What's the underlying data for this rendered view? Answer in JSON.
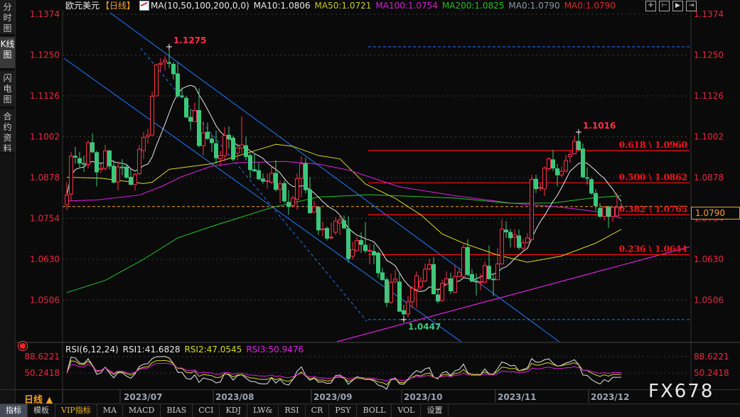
{
  "sidebar": {
    "tabs": [
      {
        "label": "分时图",
        "active": false
      },
      {
        "label": "K线图",
        "active": true
      },
      {
        "label": "闪电图",
        "active": false
      },
      {
        "label": "合约资料",
        "active": false
      }
    ]
  },
  "header": {
    "symbol": "欧元美元",
    "period": "【日线】",
    "ma_params": "MA(10,50,100,200,0,0)",
    "ma10": "MA10:1.0806",
    "ma50": "MA50:1.0721",
    "ma100": "MA100:1.0754",
    "ma200": "MA200:1.0825",
    "ma0a": "MA0:1.0790",
    "ma0b": "MA0:1.0790",
    "tool_icons": [
      "crosshair-icon",
      "zoom-range-icon",
      "play-icon",
      "exit-right-icon"
    ]
  },
  "current_price": "1.0790",
  "rsi": {
    "params": "RSI(6,12,24)",
    "rsi1": "RSI1:41.6828",
    "rsi2": "RSI2:47.0545",
    "rsi3": "RSI3:50.9476",
    "levels": [
      "88.6221",
      "50.2418"
    ]
  },
  "date_axis": {
    "period_label": "日线 ▲",
    "months": [
      "2023/07",
      "2023/08",
      "2023/09",
      "2023/10",
      "2023/11",
      "2023/12"
    ]
  },
  "bottom_tabs": [
    {
      "label": "指标",
      "active": true
    },
    {
      "label": "模板"
    },
    {
      "label": "VIP指标",
      "vip": true
    },
    {
      "label": "MA"
    },
    {
      "label": "MACD"
    },
    {
      "label": "BIAS"
    },
    {
      "label": "CCI"
    },
    {
      "label": "KDJ"
    },
    {
      "label": "LW&"
    },
    {
      "label": "RSI"
    },
    {
      "label": "CR"
    },
    {
      "label": "PSY"
    },
    {
      "label": "BOLL"
    },
    {
      "label": "VOL"
    },
    {
      "label": "设置"
    }
  ],
  "watermark": "FX678",
  "colors": {
    "up": "#ff3048",
    "down": "#3cc87c",
    "ma10": "#e8e8e8",
    "ma50": "#d8d820",
    "ma100": "#e020e0",
    "ma200": "#20c830",
    "axis_text": "#e8283c",
    "fib": "#ff1010",
    "trend": "#1e7cff",
    "support": "#e020e0",
    "last_price": "#f0a030"
  },
  "chart_data": {
    "type": "candlestick",
    "title": "欧元美元",
    "y_ticks": [
      "1.1374",
      "1.1250",
      "1.1126",
      "1.1002",
      "1.0878",
      "1.0754",
      "1.0630",
      "1.0506"
    ],
    "ylim": [
      1.038,
      1.1374
    ],
    "x_ticks": [
      "2023/07",
      "2023/08",
      "2023/09",
      "2023/10",
      "2023/11",
      "2023/12"
    ],
    "candles_ohlc": [
      [
        1.0796,
        1.0864,
        1.0779,
        1.0825
      ],
      [
        1.0828,
        1.0956,
        1.0807,
        1.0943
      ],
      [
        1.0943,
        1.0971,
        1.092,
        1.094
      ],
      [
        1.0936,
        1.0956,
        1.091,
        1.0922
      ],
      [
        1.0921,
        1.0945,
        1.0895,
        1.092
      ],
      [
        1.0918,
        1.0991,
        1.0906,
        1.0984
      ],
      [
        1.0984,
        1.1012,
        1.0952,
        1.0956
      ],
      [
        1.0954,
        1.0959,
        1.0851,
        1.0895
      ],
      [
        1.0903,
        1.092,
        1.0892,
        1.0906
      ],
      [
        1.0906,
        1.0978,
        1.0899,
        1.0959
      ],
      [
        1.0959,
        1.0963,
        1.0903,
        1.0913
      ],
      [
        1.0913,
        1.0931,
        1.086,
        1.0864
      ],
      [
        1.0865,
        1.0927,
        1.0839,
        1.091
      ],
      [
        1.091,
        1.0934,
        1.0885,
        1.0908
      ],
      [
        1.091,
        1.092,
        1.0874,
        1.0879
      ],
      [
        1.0879,
        1.0903,
        1.0855,
        1.0857
      ],
      [
        1.0857,
        1.0892,
        1.0839,
        1.0888
      ],
      [
        1.089,
        1.0977,
        1.0885,
        1.0964
      ],
      [
        1.096,
        1.1016,
        1.0934,
        1.1
      ],
      [
        1.1002,
        1.1027,
        1.0981,
        1.1007
      ],
      [
        1.1007,
        1.1139,
        1.1005,
        1.1125
      ],
      [
        1.1126,
        1.1224,
        1.1126,
        1.122
      ],
      [
        1.1222,
        1.1241,
        1.12,
        1.1225
      ],
      [
        1.1229,
        1.1246,
        1.1204,
        1.1234
      ],
      [
        1.1227,
        1.1275,
        1.1211,
        1.1225
      ],
      [
        1.1222,
        1.1229,
        1.1176,
        1.1193
      ],
      [
        1.1193,
        1.1227,
        1.1119,
        1.1126
      ],
      [
        1.1126,
        1.1151,
        1.1119,
        1.1124
      ],
      [
        1.1119,
        1.1126,
        1.1059,
        1.1062
      ],
      [
        1.1061,
        1.1087,
        1.1021,
        1.1049
      ],
      [
        1.1048,
        1.1106,
        1.1048,
        1.1082
      ],
      [
        1.1082,
        1.1149,
        1.097,
        1.0975
      ],
      [
        1.0975,
        1.1048,
        1.0945,
        1.1014
      ],
      [
        1.1016,
        1.1045,
        1.0992,
        1.0997
      ],
      [
        1.0995,
        1.1009,
        1.0956,
        1.0984
      ],
      [
        1.0981,
        1.1021,
        1.092,
        1.0938
      ],
      [
        1.0935,
        1.0959,
        1.0912,
        1.0945
      ],
      [
        1.0945,
        1.1032,
        1.0927,
        1.1006
      ],
      [
        1.1007,
        1.1034,
        1.0966,
        1.0995
      ],
      [
        1.0998,
        1.1006,
        1.0927,
        1.0934
      ],
      [
        1.0952,
        1.0981,
        1.093,
        1.0968
      ],
      [
        1.0968,
        1.1063,
        1.0952,
        1.0977
      ],
      [
        1.0975,
        1.1002,
        1.093,
        1.0942
      ],
      [
        1.0945,
        1.0952,
        1.0877,
        1.0902
      ],
      [
        1.0902,
        1.0952,
        1.0896,
        1.0898
      ],
      [
        1.0899,
        1.0923,
        1.087,
        1.0874
      ],
      [
        1.0874,
        1.0891,
        1.0859,
        1.0867
      ],
      [
        1.0866,
        1.0891,
        1.0844,
        1.0868
      ],
      [
        1.0864,
        1.0912,
        1.0859,
        1.0891
      ],
      [
        1.0891,
        1.0931,
        1.0836,
        1.0842
      ],
      [
        1.0842,
        1.0869,
        1.0801,
        1.0859
      ],
      [
        1.086,
        1.0869,
        1.0801,
        1.0807
      ],
      [
        1.0803,
        1.0841,
        1.0765,
        1.079
      ],
      [
        1.0793,
        1.0823,
        1.0787,
        1.0816
      ],
      [
        1.0812,
        1.0891,
        1.078,
        1.0875
      ],
      [
        1.0876,
        1.0942,
        1.0819,
        1.092
      ],
      [
        1.092,
        1.0938,
        1.083,
        1.0841
      ],
      [
        1.0841,
        1.088,
        1.0769,
        1.0771
      ],
      [
        1.0773,
        1.0807,
        1.0771,
        1.079
      ],
      [
        1.0788,
        1.079,
        1.0704,
        1.0719
      ],
      [
        1.072,
        1.0744,
        1.07,
        1.0722
      ],
      [
        1.0724,
        1.073,
        1.0687,
        1.0694
      ],
      [
        1.0695,
        1.0742,
        1.0692,
        1.0697
      ],
      [
        1.0712,
        1.0758,
        1.0704,
        1.0746
      ],
      [
        1.074,
        1.0765,
        1.0704,
        1.075
      ],
      [
        1.0747,
        1.0763,
        1.0722,
        1.0725
      ],
      [
        1.0723,
        1.0761,
        1.062,
        1.0632
      ],
      [
        1.0639,
        1.0683,
        1.063,
        1.0659
      ],
      [
        1.0656,
        1.0697,
        1.0654,
        1.0687
      ],
      [
        1.0687,
        1.0712,
        1.0649,
        1.0675
      ],
      [
        1.0673,
        1.0743,
        1.0649,
        1.0656
      ],
      [
        1.0655,
        1.0676,
        1.0615,
        1.0657
      ],
      [
        1.0654,
        1.0676,
        1.0615,
        1.0643
      ],
      [
        1.0649,
        1.0654,
        1.0575,
        1.0589
      ],
      [
        1.0589,
        1.0604,
        1.0565,
        1.0568
      ],
      [
        1.0568,
        1.0575,
        1.0485,
        1.0499
      ],
      [
        1.0499,
        1.0586,
        1.0495,
        1.056
      ],
      [
        1.0563,
        1.0597,
        1.0557,
        1.057
      ],
      [
        1.0561,
        1.0589,
        1.0472,
        1.0472
      ],
      [
        1.0474,
        1.0492,
        1.0447,
        1.0464
      ],
      [
        1.0464,
        1.0518,
        1.0453,
        1.0501
      ],
      [
        1.0501,
        1.0549,
        1.0482,
        1.0542
      ],
      [
        1.0539,
        1.0593,
        1.0482,
        1.058
      ],
      [
        1.0546,
        1.0575,
        1.0536,
        1.0563
      ],
      [
        1.0564,
        1.0617,
        1.056,
        1.06
      ],
      [
        1.0601,
        1.0632,
        1.0596,
        1.0614
      ],
      [
        1.0614,
        1.0636,
        1.0525,
        1.0525
      ],
      [
        1.0522,
        1.0542,
        1.0496,
        1.0503
      ],
      [
        1.0505,
        1.0568,
        1.0501,
        1.0557
      ],
      [
        1.0555,
        1.0593,
        1.055,
        1.0571
      ],
      [
        1.0571,
        1.0589,
        1.0524,
        1.0534
      ],
      [
        1.053,
        1.0611,
        1.0528,
        1.0578
      ],
      [
        1.0578,
        1.0604,
        1.0575,
        1.0591
      ],
      [
        1.0578,
        1.0675,
        1.0575,
        1.0666
      ],
      [
        1.0666,
        1.0691,
        1.0578,
        1.0584
      ],
      [
        1.0584,
        1.06,
        1.0561,
        1.0563
      ],
      [
        1.0564,
        1.0586,
        1.052,
        1.0561
      ],
      [
        1.0561,
        1.0586,
        1.0536,
        1.0562
      ],
      [
        1.0561,
        1.0623,
        1.0557,
        1.0611
      ],
      [
        1.0609,
        1.0672,
        1.0568,
        1.0571
      ],
      [
        1.057,
        1.0586,
        1.0518,
        1.0568
      ],
      [
        1.0568,
        1.0664,
        1.0566,
        1.0616
      ],
      [
        1.0616,
        1.0751,
        1.0614,
        1.0722
      ],
      [
        1.0719,
        1.0746,
        1.0695,
        1.0713
      ],
      [
        1.0712,
        1.0722,
        1.0666,
        1.0695
      ],
      [
        1.0697,
        1.0722,
        1.0665,
        1.0704
      ],
      [
        1.0701,
        1.072,
        1.0659,
        1.0666
      ],
      [
        1.0664,
        1.0691,
        1.0656,
        1.068
      ],
      [
        1.0681,
        1.0709,
        1.0678,
        1.0695
      ],
      [
        1.069,
        1.0887,
        1.0688,
        1.0873
      ],
      [
        1.0873,
        1.0887,
        1.0831,
        1.0844
      ],
      [
        1.0846,
        1.0859,
        1.0837,
        1.0848
      ],
      [
        1.0843,
        1.0912,
        1.0822,
        1.0907
      ],
      [
        1.0905,
        1.0939,
        1.0898,
        1.0935
      ],
      [
        1.0932,
        1.0962,
        1.0898,
        1.0907
      ],
      [
        1.0905,
        1.092,
        1.0851,
        1.0886
      ],
      [
        1.0886,
        1.0912,
        1.088,
        1.0897
      ],
      [
        1.0898,
        1.0947,
        1.0894,
        1.093
      ],
      [
        1.0941,
        1.0959,
        1.0923,
        1.0948
      ],
      [
        1.095,
        1.1006,
        1.0948,
        1.0988
      ],
      [
        1.0988,
        1.1016,
        1.0959,
        1.0963
      ],
      [
        1.0965,
        1.0981,
        1.0877,
        1.088
      ],
      [
        1.0878,
        1.0909,
        1.0857,
        1.0877
      ],
      [
        1.0872,
        1.0877,
        1.0826,
        1.0831
      ],
      [
        1.083,
        1.0843,
        1.0778,
        1.0793
      ],
      [
        1.0785,
        1.0801,
        1.0758,
        1.076
      ],
      [
        1.076,
        1.0793,
        1.0748,
        1.0788
      ],
      [
        1.0788,
        1.0794,
        1.0725,
        1.076
      ],
      [
        1.076,
        1.0782,
        1.0744,
        1.0788
      ],
      [
        1.0762,
        1.0832,
        1.076,
        1.0788
      ],
      [
        1.079,
        1.0801,
        1.0783,
        1.0788
      ]
    ],
    "moving_averages": {
      "MA50": [
        [
          0,
          1.0879
        ],
        [
          8,
          1.0876
        ],
        [
          18,
          1.086
        ],
        [
          20,
          1.0864
        ],
        [
          24,
          1.0903
        ],
        [
          34,
          1.092
        ],
        [
          49,
          1.0979
        ],
        [
          53,
          1.0973
        ],
        [
          59,
          1.0945
        ],
        [
          64,
          1.0935
        ],
        [
          70,
          1.0859
        ],
        [
          77,
          1.0815
        ],
        [
          83,
          1.0765
        ],
        [
          88,
          1.0707
        ],
        [
          93,
          1.0679
        ],
        [
          101,
          1.0643
        ],
        [
          108,
          1.0621
        ],
        [
          116,
          1.064
        ],
        [
          124,
          1.0679
        ],
        [
          130,
          1.0721
        ]
      ],
      "MA100": [
        [
          0,
          1.0807
        ],
        [
          7,
          1.081
        ],
        [
          17,
          1.0825
        ],
        [
          22,
          1.085
        ],
        [
          27,
          1.0881
        ],
        [
          34,
          1.0913
        ],
        [
          40,
          1.0923
        ],
        [
          51,
          1.0927
        ],
        [
          59,
          1.0919
        ],
        [
          66,
          1.0901
        ],
        [
          71,
          1.088
        ],
        [
          78,
          1.085
        ],
        [
          91,
          1.0823
        ],
        [
          104,
          1.0801
        ],
        [
          116,
          1.0788
        ],
        [
          124,
          1.0775
        ],
        [
          130,
          1.0755
        ]
      ],
      "MA200": [
        [
          0,
          1.0529
        ],
        [
          9,
          1.0566
        ],
        [
          18,
          1.063
        ],
        [
          26,
          1.0695
        ],
        [
          34,
          1.073
        ],
        [
          48,
          1.0787
        ],
        [
          59,
          1.0819
        ],
        [
          71,
          1.0826
        ],
        [
          91,
          1.0816
        ],
        [
          104,
          1.08
        ],
        [
          114,
          1.0801
        ],
        [
          123,
          1.0816
        ],
        [
          130,
          1.0823
        ]
      ]
    },
    "fibonacci": [
      {
        "label": "0.618 \\ 1.0960",
        "value": 1.096
      },
      {
        "label": "0.500 \\ 1.0862",
        "value": 1.0862
      },
      {
        "label": "0.382 \\ 1.0765",
        "value": 1.0765
      },
      {
        "label": "0.236 \\ 1.0644",
        "value": 1.0644
      }
    ],
    "dashed_levels": [
      1.1275,
      1.0447
    ],
    "last_price_line": 1.079,
    "annotations": [
      {
        "label": "1.1275",
        "value": 1.1275,
        "type": "high"
      },
      {
        "label": "1.1016",
        "value": 1.1016,
        "type": "high"
      },
      {
        "label": "1.0447",
        "value": 1.0447,
        "type": "low"
      }
    ],
    "rsi_periods": [
      6,
      12,
      24
    ],
    "grid": true
  }
}
